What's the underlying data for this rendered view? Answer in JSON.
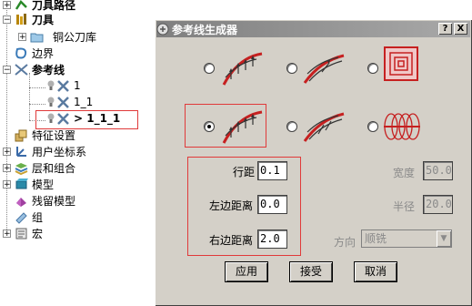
{
  "tree": {
    "items": [
      {
        "label": "刀具路径",
        "bold": true
      },
      {
        "label": "刀具",
        "bold": true
      },
      {
        "label": "铜公刀库",
        "bold": false
      },
      {
        "label": "边界",
        "bold": false
      },
      {
        "label": "参考线",
        "bold": true
      },
      {
        "label": "1",
        "bold": false
      },
      {
        "label": "1_1",
        "bold": false
      },
      {
        "label": "> 1_1_1",
        "bold": true
      },
      {
        "label": "特征设置",
        "bold": false
      },
      {
        "label": "用户坐标系",
        "bold": false
      },
      {
        "label": "层和组合",
        "bold": false
      },
      {
        "label": "模型",
        "bold": false
      },
      {
        "label": "残留模型",
        "bold": false
      },
      {
        "label": "组",
        "bold": false
      },
      {
        "label": "宏",
        "bold": false
      }
    ]
  },
  "dialog": {
    "title": "参考线生成器",
    "help_btn": "?",
    "close_btn": "X",
    "selected_option": 4,
    "fields": {
      "row_spacing": {
        "label": "行距",
        "value": "0.1"
      },
      "left_margin": {
        "label": "左边距离",
        "value": "0.0"
      },
      "right_margin": {
        "label": "右边距离",
        "value": "2.0"
      },
      "width": {
        "label": "宽度",
        "value": "50.0"
      },
      "radius": {
        "label": "半径",
        "value": "20.0"
      },
      "direction": {
        "label": "方向",
        "value": "顺铣"
      }
    },
    "buttons": {
      "apply": "应用",
      "accept": "接受",
      "cancel": "取消"
    }
  },
  "colors": {
    "dialog_bg": "#d4d0c8",
    "highlight_red": "#e03a3a",
    "curve_red": "#c62020",
    "arrow_dark": "#333333"
  }
}
